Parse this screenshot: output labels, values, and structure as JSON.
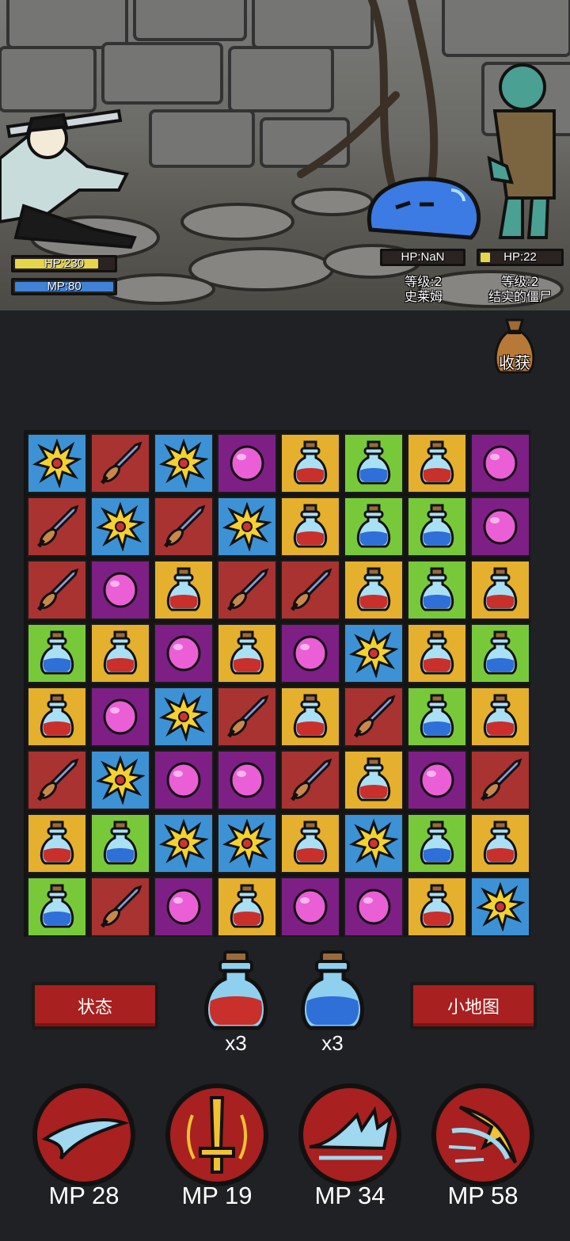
{
  "player": {
    "hp_label": "HP:230",
    "mp_label": "MP:80",
    "hp_fill": 0.85,
    "mp_fill": 1.0
  },
  "enemies": [
    {
      "hp_label": "HP:NaN",
      "level": "等级:2",
      "name": "史莱姆",
      "hp_fill": 0.0
    },
    {
      "hp_label": "HP:22",
      "level": "等级:2",
      "name": "结实的僵尸",
      "hp_fill": 0.12
    }
  ],
  "harvest": {
    "label": "收获"
  },
  "board": {
    "rows": [
      [
        "burst",
        "sword",
        "burst",
        "orb",
        "hpot",
        "mpot",
        "hpot",
        "orb"
      ],
      [
        "sword",
        "burst",
        "sword",
        "burst",
        "hpot",
        "mpot",
        "mpot",
        "orb"
      ],
      [
        "sword",
        "orb",
        "hpot",
        "sword",
        "sword",
        "hpot",
        "mpot",
        "hpot"
      ],
      [
        "mpot",
        "hpot",
        "orb",
        "hpot",
        "orb",
        "burst",
        "hpot",
        "mpot"
      ],
      [
        "hpot",
        "orb",
        "burst",
        "sword",
        "hpot",
        "sword",
        "mpot",
        "hpot"
      ],
      [
        "sword",
        "burst",
        "orb",
        "orb",
        "sword",
        "hpot",
        "orb",
        "sword"
      ],
      [
        "hpot",
        "mpot",
        "burst",
        "burst",
        "hpot",
        "burst",
        "mpot",
        "hpot"
      ],
      [
        "mpot",
        "sword",
        "orb",
        "hpot",
        "orb",
        "orb",
        "hpot",
        "burst"
      ]
    ]
  },
  "controls": {
    "status_label": "状态",
    "minimap_label": "小地图",
    "red_potion_count": "x3",
    "blue_potion_count": "x3"
  },
  "skills": [
    {
      "icon": "wind-slash-icon",
      "cost": "MP 28"
    },
    {
      "icon": "sword-aura-icon",
      "cost": "MP 19"
    },
    {
      "icon": "wave-strike-icon",
      "cost": "MP 34"
    },
    {
      "icon": "whirl-burst-icon",
      "cost": "MP 58"
    }
  ],
  "colors": {
    "sword": "#a83330",
    "burst": "#3c92d4",
    "orb": "#7e1f86",
    "hpot": "#e4b02d",
    "mpot": "#78c93a",
    "button": "#a8201f"
  }
}
